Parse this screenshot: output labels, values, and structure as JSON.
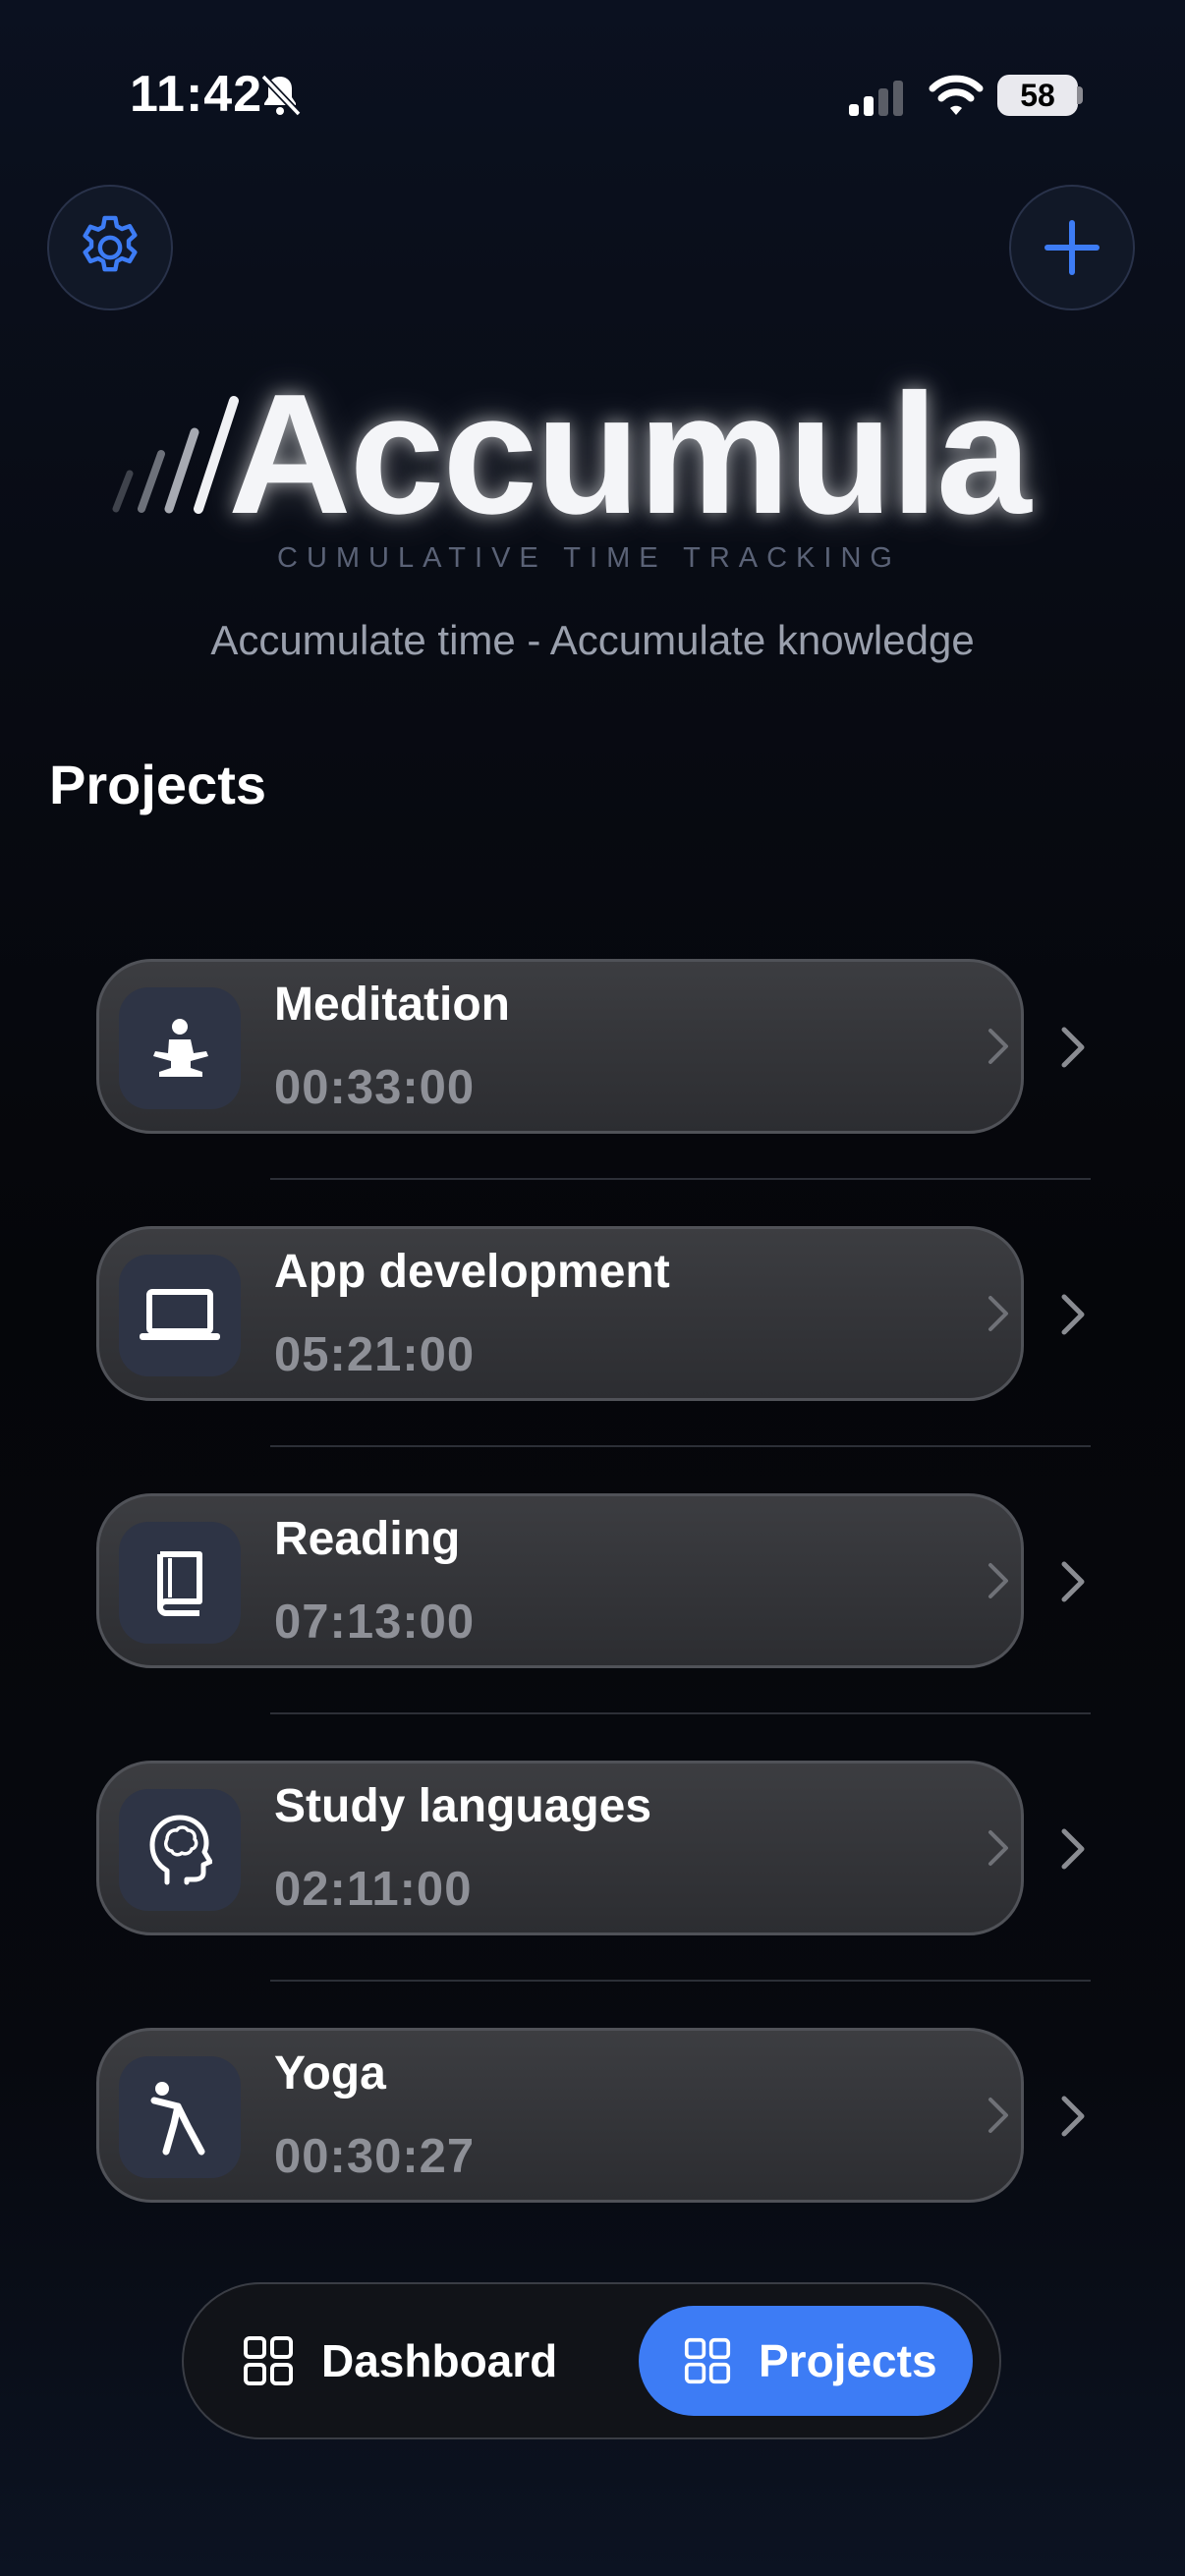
{
  "status_bar": {
    "time": "11:42",
    "battery": "58"
  },
  "header": {
    "settings_icon": "gear-icon",
    "add_icon": "plus-icon",
    "accent_color": "#3d7cf5"
  },
  "branding": {
    "logo": "Accumula",
    "subtitle": "CUMULATIVE TIME TRACKING",
    "tagline": "Accumulate time - Accumulate knowledge"
  },
  "section_title": "Projects",
  "projects": [
    {
      "name": "Meditation",
      "time": "00:33:00",
      "icon": "meditation-icon"
    },
    {
      "name": "App development",
      "time": "05:21:00",
      "icon": "laptop-icon"
    },
    {
      "name": "Reading",
      "time": "07:13:00",
      "icon": "book-icon"
    },
    {
      "name": "Study languages",
      "time": "02:11:00",
      "icon": "brain-head-icon"
    },
    {
      "name": "Yoga",
      "time": "00:30:27",
      "icon": "yoga-icon"
    }
  ],
  "tab_bar": {
    "tabs": [
      {
        "label": "Dashboard",
        "icon": "grid-icon",
        "selected": false
      },
      {
        "label": "Projects",
        "icon": "grid-icon",
        "selected": true
      }
    ]
  }
}
